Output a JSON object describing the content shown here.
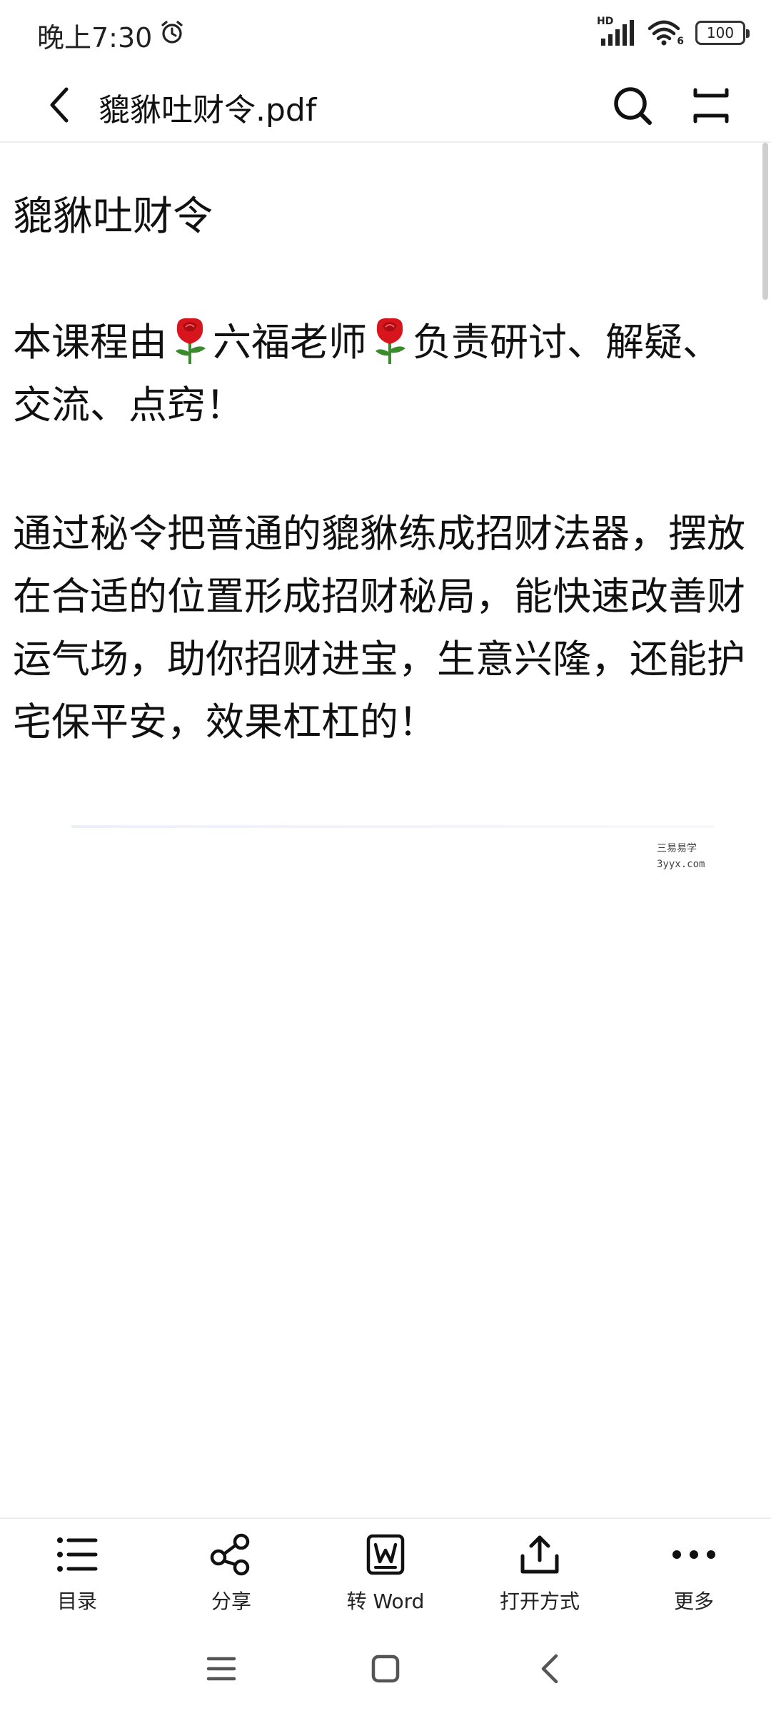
{
  "status_bar": {
    "time": "晚上7:30",
    "network": "HD",
    "wifi_sub": "6",
    "battery": "100"
  },
  "header": {
    "title": "貔貅吐财令.pdf"
  },
  "document": {
    "heading": "貔貅吐财令",
    "para1": {
      "before": "本课程由",
      "name": "六福老师",
      "after": "负责研讨、解疑、交流、点窍！"
    },
    "para2": "通过秘令把普通的貔貅练成招财法器，摆放在合适的位置形成招财秘局，能快速改善财运气场，助你招财进宝，生意兴隆，还能护宅保平安，效果杠杠的！",
    "watermark_line1": "三易易学",
    "watermark_line2": "3yyx.com"
  },
  "toolbar": {
    "items": [
      {
        "label": "目录",
        "icon": "list-icon"
      },
      {
        "label": "分享",
        "icon": "share-icon"
      },
      {
        "label": "转 Word",
        "icon": "word-icon"
      },
      {
        "label": "打开方式",
        "icon": "upload-icon"
      },
      {
        "label": "更多",
        "icon": "more-icon"
      }
    ]
  },
  "colors": {
    "text": "#111111",
    "rose_red": "#d8141c",
    "rose_green": "#3c8a2e",
    "divider": "#ececec"
  }
}
